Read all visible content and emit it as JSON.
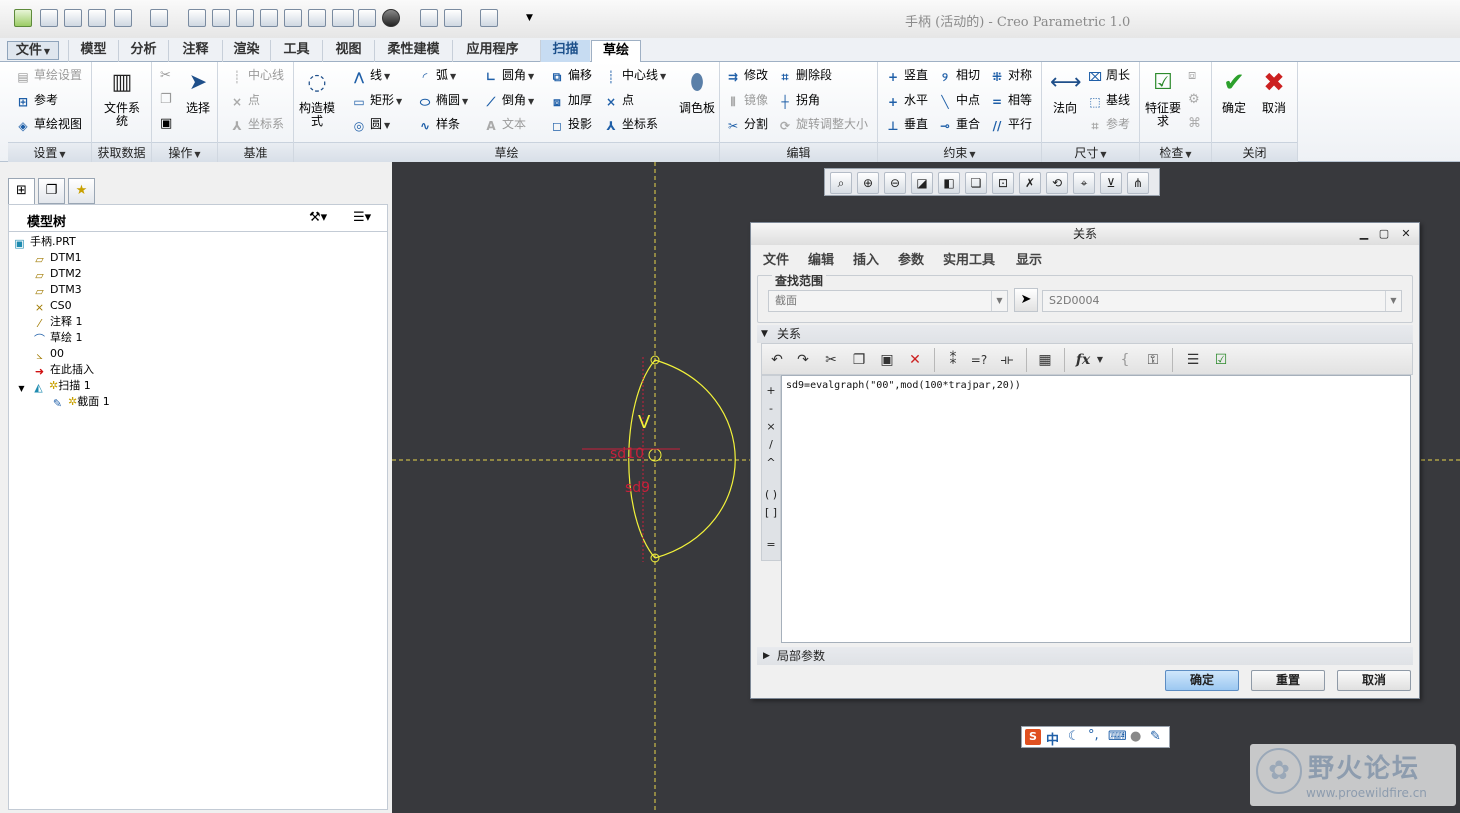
{
  "window_title": "手柄 (活动的) - Creo Parametric 1.0",
  "tabs": [
    "文件",
    "模型",
    "分析",
    "注释",
    "渲染",
    "工具",
    "视图",
    "柔性建模",
    "应用程序",
    "扫描",
    "草绘"
  ],
  "ribbon": {
    "groups": {
      "settings": {
        "label": "设置",
        "items": [
          "草绘设置",
          "参考",
          "草绘视图"
        ]
      },
      "getdata": {
        "label": "获取数据",
        "big": "文件系统"
      },
      "ops": {
        "label": "操作",
        "big": "选择"
      },
      "datum": {
        "label": "基准",
        "items": [
          "中心线",
          "点",
          "坐标系"
        ]
      },
      "sketch": {
        "label": "草绘",
        "construct": "构造模式",
        "palette": "调色板",
        "col1": [
          "线",
          "矩形",
          "圆"
        ],
        "col2": [
          "弧",
          "椭圆",
          "样条"
        ],
        "col3": [
          "圆角",
          "倒角",
          "文本"
        ],
        "col4": [
          "偏移",
          "加厚",
          "投影"
        ],
        "col5": [
          "中心线",
          "点",
          "坐标系"
        ]
      },
      "edit": {
        "label": "编辑",
        "col1": [
          "修改",
          "镜像",
          "分割"
        ],
        "col2": [
          "删除段",
          "拐角",
          "旋转调整大小"
        ]
      },
      "constrain": {
        "label": "约束",
        "col1": [
          "竖直",
          "水平",
          "垂直"
        ],
        "col2": [
          "相切",
          "中点",
          "重合"
        ],
        "col3": [
          "对称",
          "相等",
          "平行"
        ]
      },
      "dimension": {
        "label": "尺寸",
        "big": "法向",
        "items": [
          "周长",
          "基线",
          "参考"
        ]
      },
      "inspect": {
        "label": "检查",
        "big": "特征要求"
      },
      "close": {
        "label": "关闭",
        "ok": "确定",
        "cancel": "取消"
      }
    }
  },
  "model_tree": {
    "title": "模型树",
    "nodes": [
      "手柄.PRT",
      "DTM1",
      "DTM2",
      "DTM3",
      "CS0",
      "注释 1",
      "草绘 1",
      "00",
      "在此插入",
      "扫描 1",
      "截面 1"
    ]
  },
  "sketch_labels": {
    "v": "V",
    "dim1": "sd10",
    "dim2": "sd9"
  },
  "dialog": {
    "title": "关系",
    "menu": [
      "文件",
      "编辑",
      "插入",
      "参数",
      "实用工具",
      "显示"
    ],
    "scope_label": "查找范围",
    "scope_type": "截面",
    "scope_item": "S2D0004",
    "relations_label": "关系",
    "operators": [
      "+",
      "-",
      "×",
      "/",
      "^",
      "( )",
      "[ ]",
      "="
    ],
    "fx": "fx",
    "relation_text": "sd9=evalgraph(\"00\",mod(100*trajpar,20))",
    "local_params": "局部参数",
    "ok": "确定",
    "reset": "重置",
    "cancel": "取消"
  },
  "ime": {
    "mode": "中"
  },
  "watermark": {
    "name": "野火论坛",
    "url": "www.proewildfire.cn"
  }
}
